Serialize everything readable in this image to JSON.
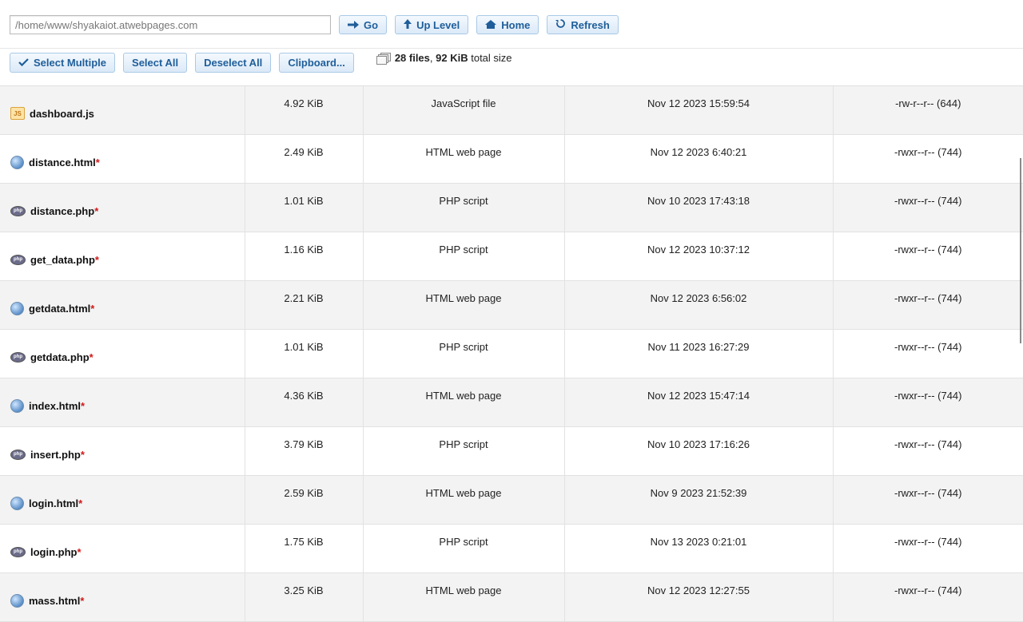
{
  "toolbar": {
    "path_value": "/home/www/shyakaiot.atwebpages.com",
    "go_label": "Go",
    "up_level_label": "Up Level",
    "home_label": "Home",
    "refresh_label": "Refresh"
  },
  "actions": {
    "select_multiple_label": "Select Multiple",
    "select_all_label": "Select All",
    "deselect_all_label": "Deselect All",
    "clipboard_label": "Clipboard..."
  },
  "summary": {
    "file_count": "28 files",
    "separator": ", ",
    "total_size": "92 KiB",
    "suffix": " total size"
  },
  "files": [
    {
      "name": "dashboard.js",
      "modified": false,
      "icon": "js-file-icon",
      "size": "4.92 KiB",
      "type": "JavaScript file",
      "date": "Nov 12 2023 15:59:54",
      "perm": "-rw-r--r-- (644)"
    },
    {
      "name": "distance.html",
      "modified": true,
      "icon": "html-file-icon",
      "size": "2.49 KiB",
      "type": "HTML web page",
      "date": "Nov 12 2023 6:40:21",
      "perm": "-rwxr--r-- (744)"
    },
    {
      "name": "distance.php",
      "modified": true,
      "icon": "php-file-icon",
      "size": "1.01 KiB",
      "type": "PHP script",
      "date": "Nov 10 2023 17:43:18",
      "perm": "-rwxr--r-- (744)"
    },
    {
      "name": "get_data.php",
      "modified": true,
      "icon": "php-file-icon",
      "size": "1.16 KiB",
      "type": "PHP script",
      "date": "Nov 12 2023 10:37:12",
      "perm": "-rwxr--r-- (744)"
    },
    {
      "name": "getdata.html",
      "modified": true,
      "icon": "html-file-icon",
      "size": "2.21 KiB",
      "type": "HTML web page",
      "date": "Nov 12 2023 6:56:02",
      "perm": "-rwxr--r-- (744)"
    },
    {
      "name": "getdata.php",
      "modified": true,
      "icon": "php-file-icon",
      "size": "1.01 KiB",
      "type": "PHP script",
      "date": "Nov 11 2023 16:27:29",
      "perm": "-rwxr--r-- (744)"
    },
    {
      "name": "index.html",
      "modified": true,
      "icon": "html-file-icon",
      "size": "4.36 KiB",
      "type": "HTML web page",
      "date": "Nov 12 2023 15:47:14",
      "perm": "-rwxr--r-- (744)"
    },
    {
      "name": "insert.php",
      "modified": true,
      "icon": "php-file-icon",
      "size": "3.79 KiB",
      "type": "PHP script",
      "date": "Nov 10 2023 17:16:26",
      "perm": "-rwxr--r-- (744)"
    },
    {
      "name": "login.html",
      "modified": true,
      "icon": "html-file-icon",
      "size": "2.59 KiB",
      "type": "HTML web page",
      "date": "Nov 9 2023 21:52:39",
      "perm": "-rwxr--r-- (744)"
    },
    {
      "name": "login.php",
      "modified": true,
      "icon": "php-file-icon",
      "size": "1.75 KiB",
      "type": "PHP script",
      "date": "Nov 13 2023 0:21:01",
      "perm": "-rwxr--r-- (744)"
    },
    {
      "name": "mass.html",
      "modified": true,
      "icon": "html-file-icon",
      "size": "3.25 KiB",
      "type": "HTML web page",
      "date": "Nov 12 2023 12:27:55",
      "perm": "-rwxr--r-- (744)"
    }
  ],
  "modified_marker": "*",
  "colors": {
    "button_text": "#1f5e9a",
    "row_alt": "#f3f3f3",
    "modified_marker": "#d01818"
  }
}
